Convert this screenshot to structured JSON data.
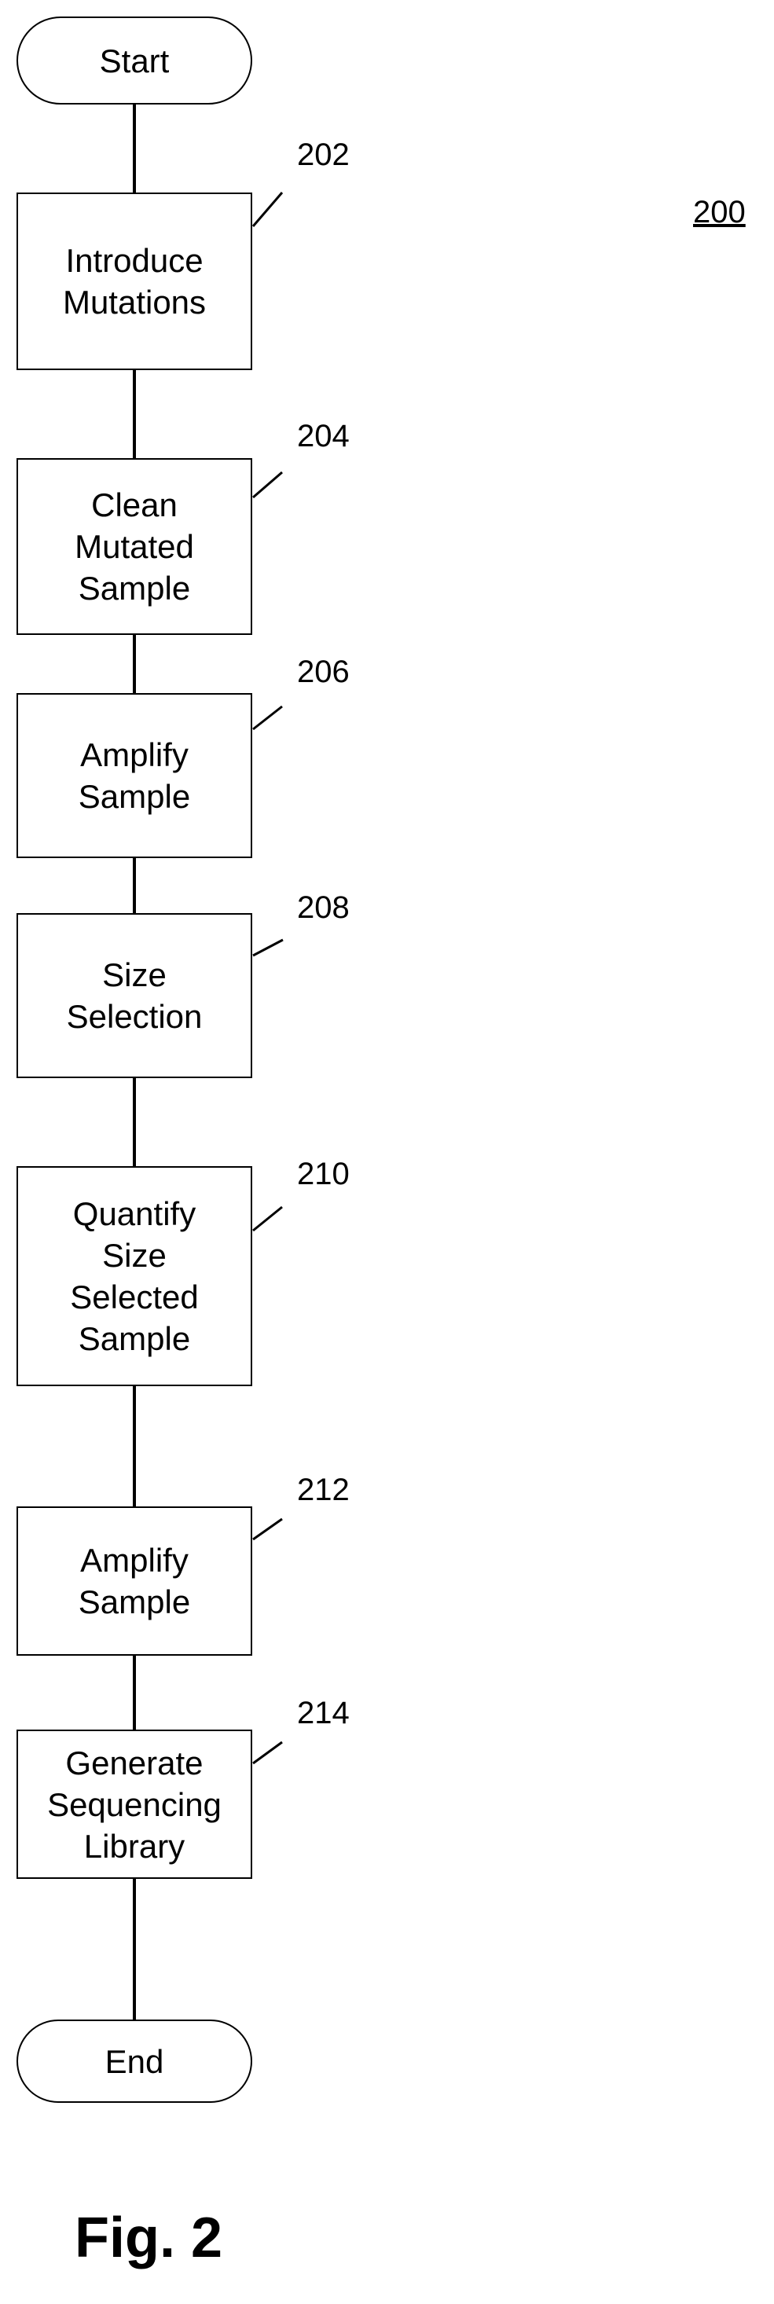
{
  "figure": {
    "id": "200",
    "caption": "Fig. 2"
  },
  "flow": {
    "start": "Start",
    "end": "End",
    "steps": [
      {
        "ref": "202",
        "label": "Introduce\nMutations"
      },
      {
        "ref": "204",
        "label": "Clean\nMutated\nSample"
      },
      {
        "ref": "206",
        "label": "Amplify\nSample"
      },
      {
        "ref": "208",
        "label": "Size\nSelection"
      },
      {
        "ref": "210",
        "label": "Quantify\nSize\nSelected\nSample"
      },
      {
        "ref": "212",
        "label": "Amplify\nSample"
      },
      {
        "ref": "214",
        "label": "Generate\nSequencing\nLibrary"
      }
    ]
  },
  "colors": {
    "line": "#000000",
    "background": "#ffffff"
  }
}
